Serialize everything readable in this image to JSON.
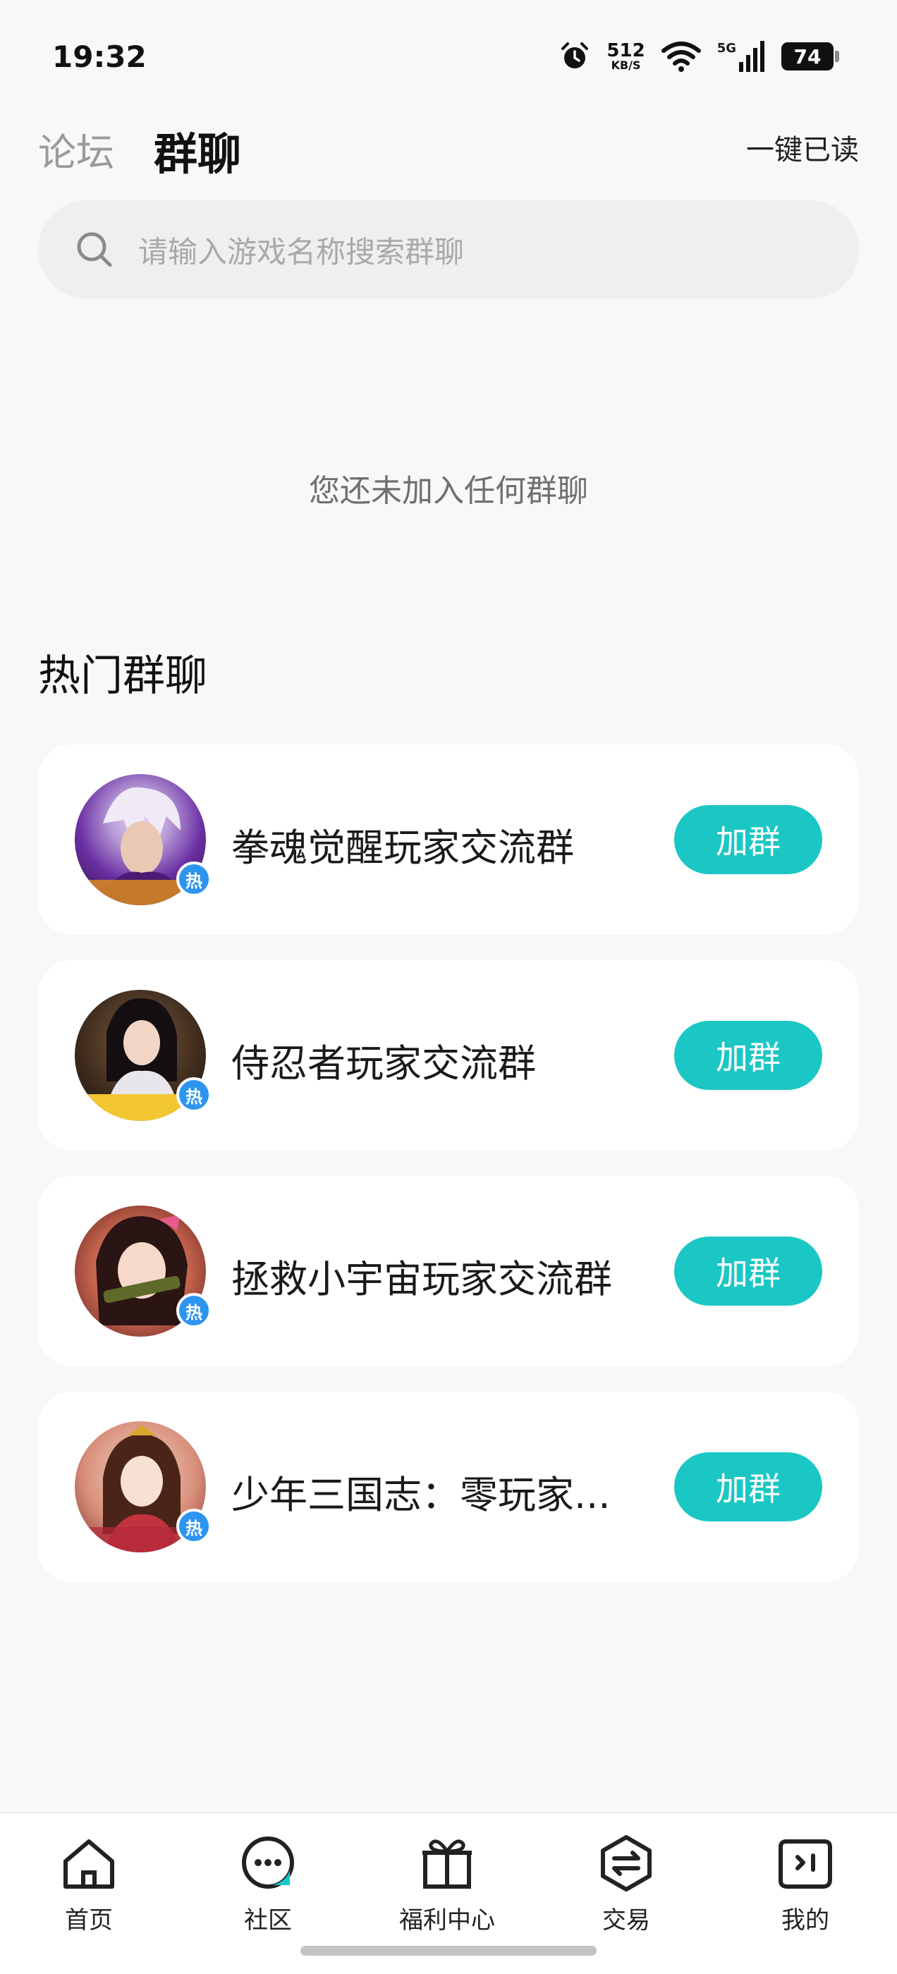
{
  "status_bar": {
    "time": "19:32",
    "net_speed_value": "512",
    "net_speed_unit": "KB/S",
    "network": "5G",
    "battery": "74",
    "icons": [
      "alarm-icon",
      "wifi-icon",
      "signal-icon",
      "battery-icon"
    ]
  },
  "header": {
    "tab_forum": "论坛",
    "tab_group_chat": "群聊",
    "mark_all_read": "一键已读"
  },
  "search": {
    "placeholder": "请输入游戏名称搜索群聊"
  },
  "empty_state": {
    "text": "您还未加入任何群聊"
  },
  "hot_groups": {
    "title": "热门群聊",
    "badge": "热",
    "join_label": "加群",
    "items": [
      {
        "name": "拳魂觉醒玩家交流群"
      },
      {
        "name": "侍忍者玩家交流群"
      },
      {
        "name": "拯救小宇宙玩家交流群"
      },
      {
        "name": "少年三国志：零玩家..."
      }
    ]
  },
  "bottom_nav": {
    "items": [
      {
        "label": "首页",
        "icon": "home-icon"
      },
      {
        "label": "社区",
        "icon": "community-chat-icon"
      },
      {
        "label": "福利中心",
        "icon": "gift-icon"
      },
      {
        "label": "交易",
        "icon": "trade-icon"
      },
      {
        "label": "我的",
        "icon": "profile-icon"
      }
    ]
  },
  "colors": {
    "accent": "#1bc7c4",
    "hot_badge": "#2d95f0",
    "background": "#f8f8f8"
  }
}
